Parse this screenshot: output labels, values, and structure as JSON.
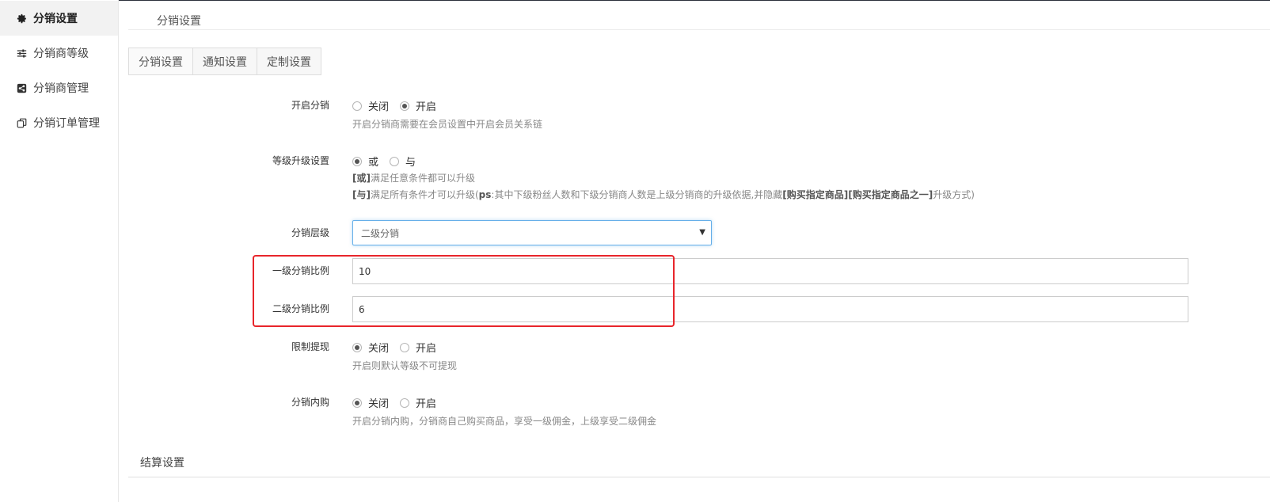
{
  "sidebar": {
    "items": [
      {
        "label": "分销设置",
        "icon": "gear-icon"
      },
      {
        "label": "分销商等级",
        "icon": "sliders-icon"
      },
      {
        "label": "分销商管理",
        "icon": "share-icon"
      },
      {
        "label": "分销订单管理",
        "icon": "copy-icon"
      }
    ]
  },
  "header": {
    "title": "分销设置"
  },
  "tabs": [
    {
      "label": "分销设置"
    },
    {
      "label": "通知设置"
    },
    {
      "label": "定制设置"
    }
  ],
  "form": {
    "enable_distribution": {
      "label": "开启分销",
      "options": [
        "关闭",
        "开启"
      ],
      "selected": "开启",
      "help": "开启分销商需要在会员设置中开启会员关系链"
    },
    "level_upgrade": {
      "label": "等级升级设置",
      "options": [
        "或",
        "与"
      ],
      "selected": "或",
      "help_or_tag": "[或]",
      "help_or_text": "满足任意条件都可以升级",
      "help_and_tag": "[与]",
      "help_and_text1": "满足所有条件才可以升级(",
      "help_and_ps": "ps",
      "help_and_text2": ":其中下级粉丝人数和下级分销商人数是上级分销商的升级依据,并隐藏",
      "help_and_goods1": "[购买指定商品]",
      "help_and_goods2": "[购买指定商品之一]",
      "help_and_text3": "升级方式)"
    },
    "distribution_level": {
      "label": "分销层级",
      "value": "二级分销"
    },
    "level1_ratio": {
      "label": "一级分销比例",
      "value": "10"
    },
    "level2_ratio": {
      "label": "二级分销比例",
      "value": "6"
    },
    "withdraw_limit": {
      "label": "限制提现",
      "options": [
        "关闭",
        "开启"
      ],
      "selected": "关闭",
      "help": "开启则默认等级不可提现"
    },
    "internal_purchase": {
      "label": "分销内购",
      "options": [
        "关闭",
        "开启"
      ],
      "selected": "关闭",
      "help": "开启分销内购，分销商自己购买商品，享受一级佣金，上级享受二级佣金"
    }
  },
  "settlement": {
    "title": "结算设置"
  },
  "colors": {
    "highlight": "#e8252b",
    "focus_border": "#66afe9"
  }
}
